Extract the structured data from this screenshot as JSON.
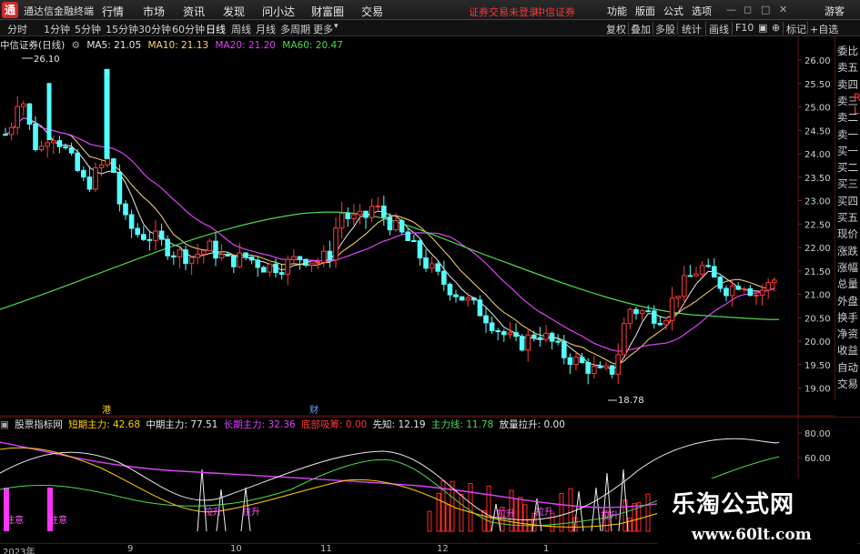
{
  "menubar": {
    "logo_glyph": "通",
    "app_name": "通达信金融终端",
    "items": [
      "行情",
      "市场",
      "资讯",
      "发现",
      "问小达",
      "财富圈",
      "交易"
    ],
    "login_warning": "证券交易未登录",
    "broker": "中信证券",
    "right_items": [
      "功能",
      "版面",
      "公式",
      "选项",
      "游客"
    ]
  },
  "periods": {
    "items": [
      "分时",
      "1分钟",
      "5分钟",
      "15分钟",
      "30分钟",
      "60分钟",
      "日线",
      "周线",
      "月线",
      "多周期",
      "更多"
    ],
    "active": "日线"
  },
  "toolbar": {
    "items": [
      "复权",
      "叠加",
      "多股",
      "统计",
      "画线",
      "F10",
      "标记",
      "+自选"
    ]
  },
  "stock": {
    "name": "中信证券(日线)",
    "ma5_label": "MA5: 21.05",
    "ma10_label": "MA10: 21.13",
    "ma20_label": "MA20: 21.20",
    "ma60_label": "MA60: 20.47",
    "high_label": "26.10",
    "low_label": "18.78",
    "marker_gang": "港",
    "marker_cai": "财"
  },
  "colors": {
    "up": "#ff3b3b",
    "down": "#54ffff",
    "ma5": "#e8e8e8",
    "ma10": "#ffd86b",
    "ma20": "#e040fb",
    "ma60": "#4cd94c",
    "axis_border": "#5a1010"
  },
  "price_axis": [
    "26.00",
    "25.50",
    "25.00",
    "24.50",
    "24.00",
    "23.50",
    "23.00",
    "22.50",
    "22.00",
    "21.50",
    "21.00",
    "20.50",
    "20.00",
    "19.50",
    "19.00"
  ],
  "side_panel": {
    "labels": [
      "委比",
      "卖五",
      "卖四",
      "卖三",
      "卖二",
      "卖一",
      "买一",
      "买二",
      "买三",
      "买四",
      "买五",
      "现价",
      "涨跌",
      "涨幅",
      "总量",
      "外盘",
      "换手",
      "净资",
      "收益",
      "自动",
      "交易"
    ],
    "letters": [
      "L",
      "R"
    ]
  },
  "indicator": {
    "name": "股票指标网",
    "short_label": "短期主力: 42.68",
    "mid_label": "中期主力: 77.51",
    "long_label": "长期主力: 32.36",
    "bottom_label": "底部吸筹: 0.00",
    "lead_label": "先知: 12.19",
    "main_label": "主力线: 11.78",
    "pull_label": "放量拉升: 0.00",
    "axis": [
      "80.00",
      "60.00"
    ],
    "tags": [
      "注意",
      "注意",
      "拉升",
      "拉升",
      "拉升",
      "拉升",
      "拉升"
    ]
  },
  "dates": [
    "2023年",
    "9",
    "10",
    "11",
    "12",
    "1"
  ],
  "watermark": {
    "title": "乐淘公式网",
    "url": "www.60lt.com"
  }
}
